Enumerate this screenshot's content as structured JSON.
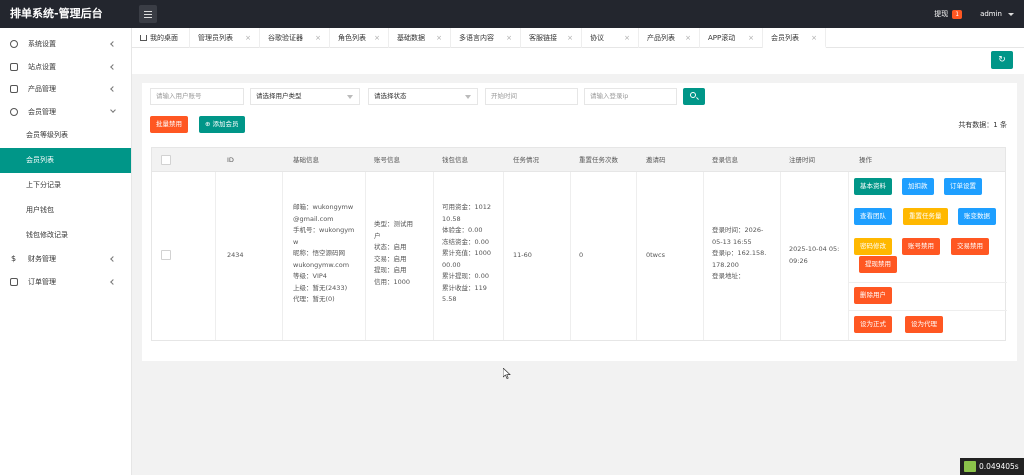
{
  "app": {
    "title": "排单系统-管理后台"
  },
  "header": {
    "withdraw_label": "提现",
    "withdraw_badge": "1",
    "user": "admin"
  },
  "sidebar": {
    "items": [
      {
        "label": "系统设置",
        "icon": "gear-icon"
      },
      {
        "label": "站点设置",
        "icon": "bell-icon"
      },
      {
        "label": "产品管理",
        "icon": "box-icon"
      },
      {
        "label": "会员管理",
        "icon": "user-icon"
      }
    ],
    "sub": [
      {
        "label": "会员等级列表"
      },
      {
        "label": "会员列表"
      },
      {
        "label": "上下分记录"
      },
      {
        "label": "用户钱包"
      },
      {
        "label": "钱包修改记录"
      }
    ],
    "after": [
      {
        "label": "财务管理",
        "icon": "dollar-icon"
      },
      {
        "label": "订单管理",
        "icon": "cube-icon"
      }
    ]
  },
  "tabs": [
    {
      "label": "我的桌面"
    },
    {
      "label": "管理员列表"
    },
    {
      "label": "谷歌验证器"
    },
    {
      "label": "角色列表"
    },
    {
      "label": "基础数据"
    },
    {
      "label": "多语言内容"
    },
    {
      "label": "客服链接"
    },
    {
      "label": "协议"
    },
    {
      "label": "产品列表"
    },
    {
      "label": "APP滚动"
    },
    {
      "label": "会员列表"
    }
  ],
  "search": {
    "account_placeholder": "请输入用户账号",
    "user_type": "请选择用户类型",
    "status": "请选择状态",
    "start_time_placeholder": "开始时间",
    "ip_placeholder": "请输入登录ip"
  },
  "actions": {
    "batch_ban": "批量禁用",
    "add_member": "添加会员"
  },
  "total_text": "共有数据：1 条",
  "table": {
    "headers": [
      "ID",
      "基础信息",
      "账号信息",
      "钱包信息",
      "任务情况",
      "重置任务次数",
      "邀请码",
      "登录信息",
      "注册时间",
      "操作"
    ],
    "row": {
      "id": "2434",
      "basic": [
        "邮箱：wukongymw",
        "@gmail.com",
        "手机号：wukongym",
        "w",
        "昵称：悟空源码网",
        "wukongymw.com",
        "等级：VIP4",
        "上级：暂无(2433)",
        "代理：暂无(0)"
      ],
      "account": [
        "类型：测试用",
        "户",
        "状态：启用",
        "交易：启用",
        "提现：启用",
        "信用：1000"
      ],
      "wallet": [
        "可用资金：1012",
        "10.58",
        "体验金：0.00",
        "冻结资金：0.00",
        "累计充值：1000",
        "00.00",
        "累计提现：0.00",
        "累计收益：119",
        "5.58"
      ],
      "task": "11-60",
      "reset": "0",
      "invite": "0twcs",
      "login": [
        "登录时间：2026-",
        "05-13 16:55",
        "登录ip：162.158.",
        "178.200",
        "登录地址："
      ],
      "register": [
        "2025-10-04 05:",
        "09:26"
      ]
    },
    "ops": {
      "basic_info": "基本资料",
      "add_deduct": "加扣款",
      "order_settings": "订单设置",
      "view_team": "查看团队",
      "reset_task": "重置任务量",
      "account_change": "账变数据",
      "password_change": "密码修改",
      "ban_account": "账号禁用",
      "ban_trade": "交易禁用",
      "ban_withdraw": "提现禁用",
      "delete_user": "删除用户",
      "set_formal": "设为正式",
      "set_agent": "设为代理"
    }
  },
  "footer": {
    "timer": "0.049405s"
  },
  "colors": {
    "primary": "#009688",
    "danger": "#ff5722",
    "info": "#1e9fff",
    "warn": "#ffb800",
    "topbar": "#23262e"
  }
}
